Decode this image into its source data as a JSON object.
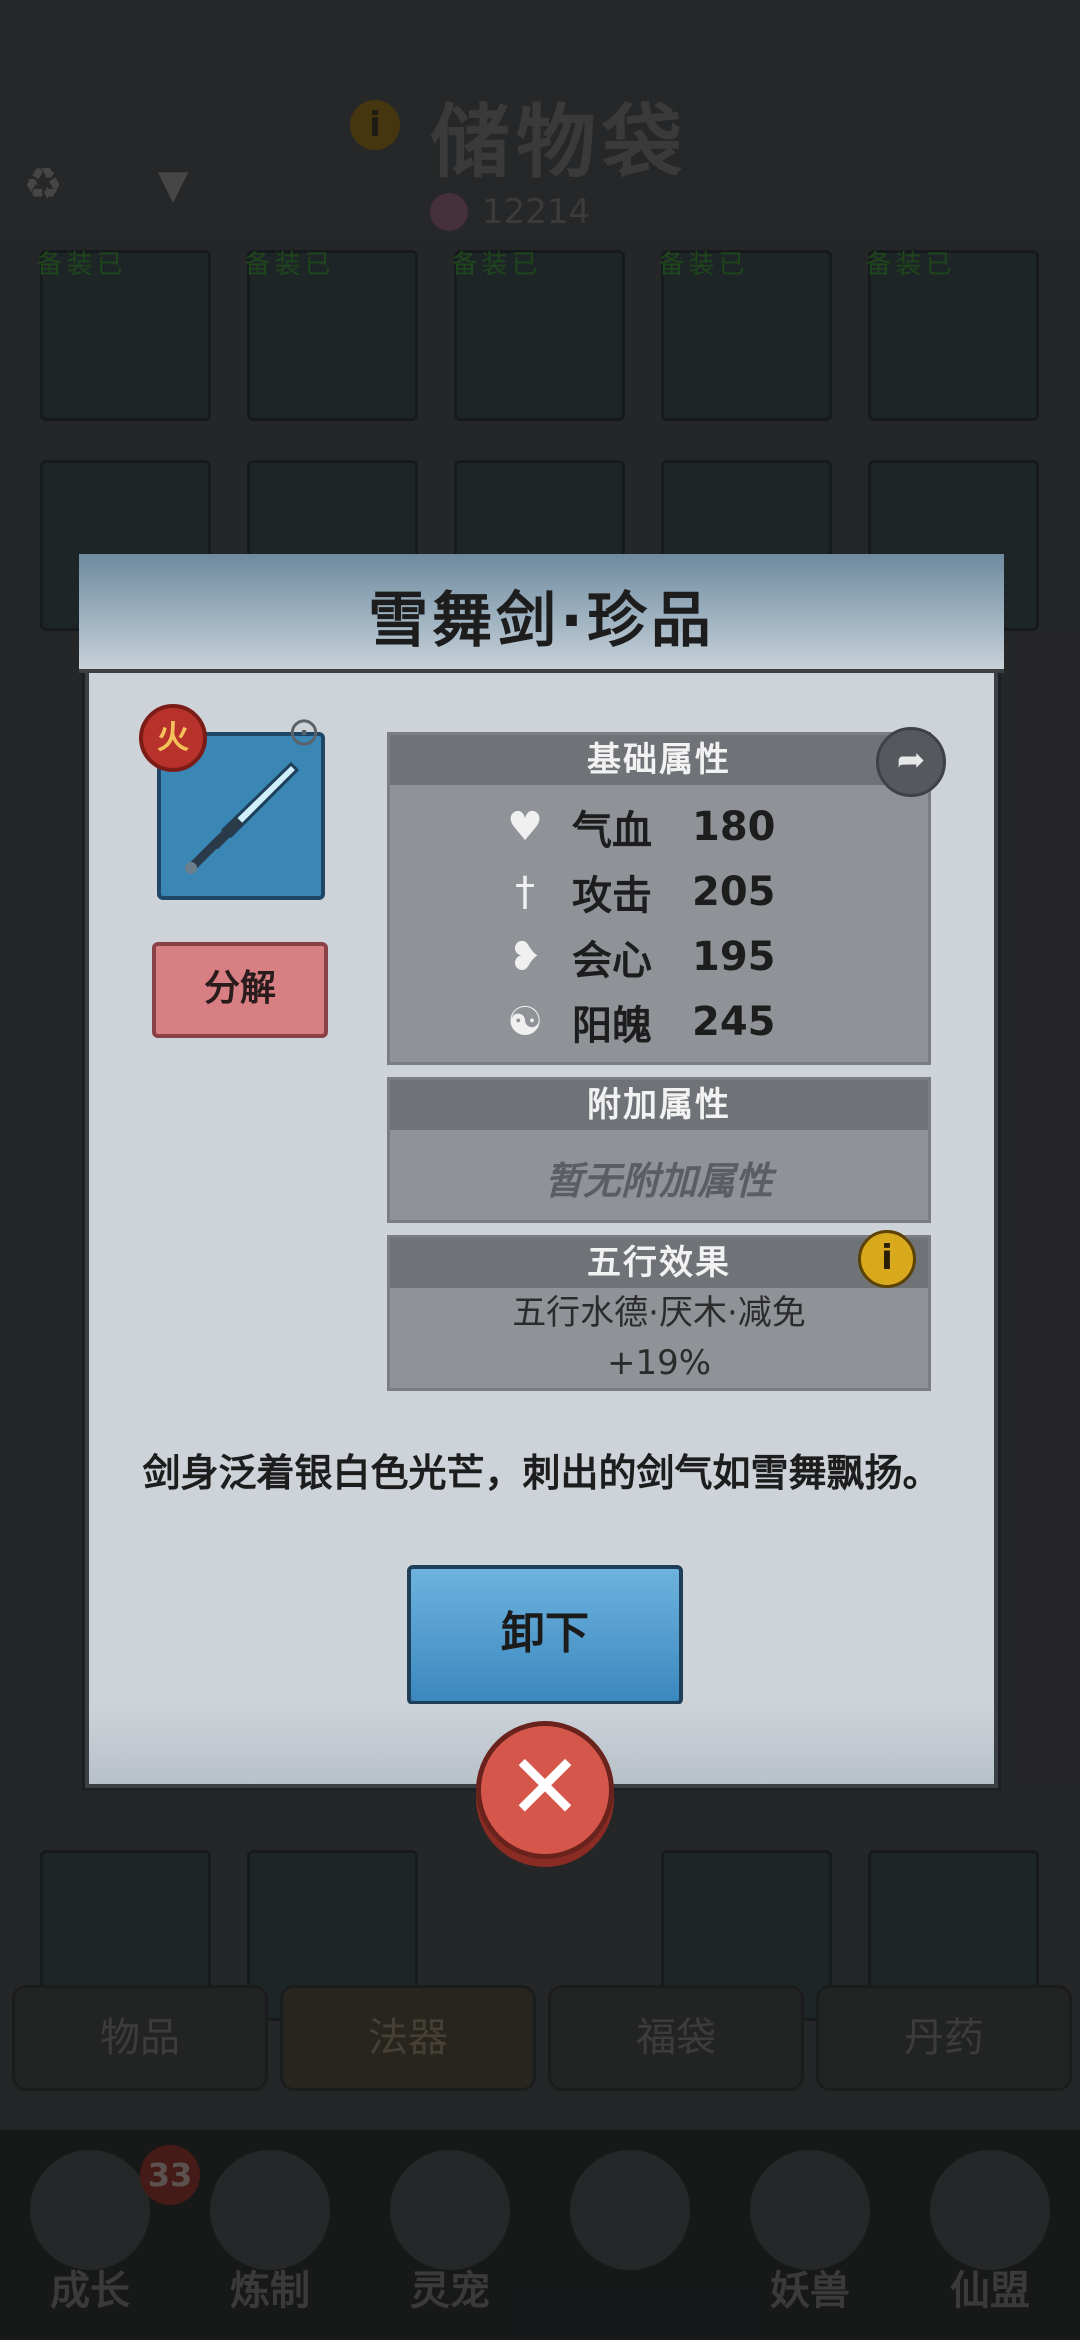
{
  "background": {
    "title": "储物袋",
    "currency_value": "12214",
    "equipped_label": "已装备",
    "tabs": [
      "物品",
      "法器",
      "福袋",
      "丹药"
    ],
    "active_tab": "法器",
    "nav": [
      {
        "label": "成长",
        "badge": "33"
      },
      {
        "label": "炼制"
      },
      {
        "label": "灵宠"
      },
      {
        "label": ""
      },
      {
        "label": "妖兽"
      },
      {
        "label": "仙盟"
      }
    ]
  },
  "dialog": {
    "title": "雪舞剑·珍品",
    "element_badge": "火",
    "decompose_label": "分解",
    "basic": {
      "header": "基础属性",
      "stats": [
        {
          "icon": "heart-icon",
          "name": "气血",
          "value": "180"
        },
        {
          "icon": "sword-icon",
          "name": "攻击",
          "value": "205"
        },
        {
          "icon": "crit-heart-icon",
          "name": "会心",
          "value": "195"
        },
        {
          "icon": "flame-icon",
          "name": "阳魄",
          "value": "245"
        }
      ]
    },
    "extra": {
      "header": "附加属性",
      "empty_text": "暂无附加属性"
    },
    "wuxing": {
      "header": "五行效果",
      "line1": "五行水德·厌木·减免",
      "line2": "+19%"
    },
    "description": "剑身泛着银白色光芒，刺出的剑气如雪舞飘扬。",
    "unequip_label": "卸下"
  },
  "colors": {
    "dialog_bg": "#cdd3d9",
    "panel_bg": "#8f9398",
    "unequip_btn": "#3b88bf",
    "decompose_btn": "#d87f84",
    "close_btn": "#d5574b"
  }
}
